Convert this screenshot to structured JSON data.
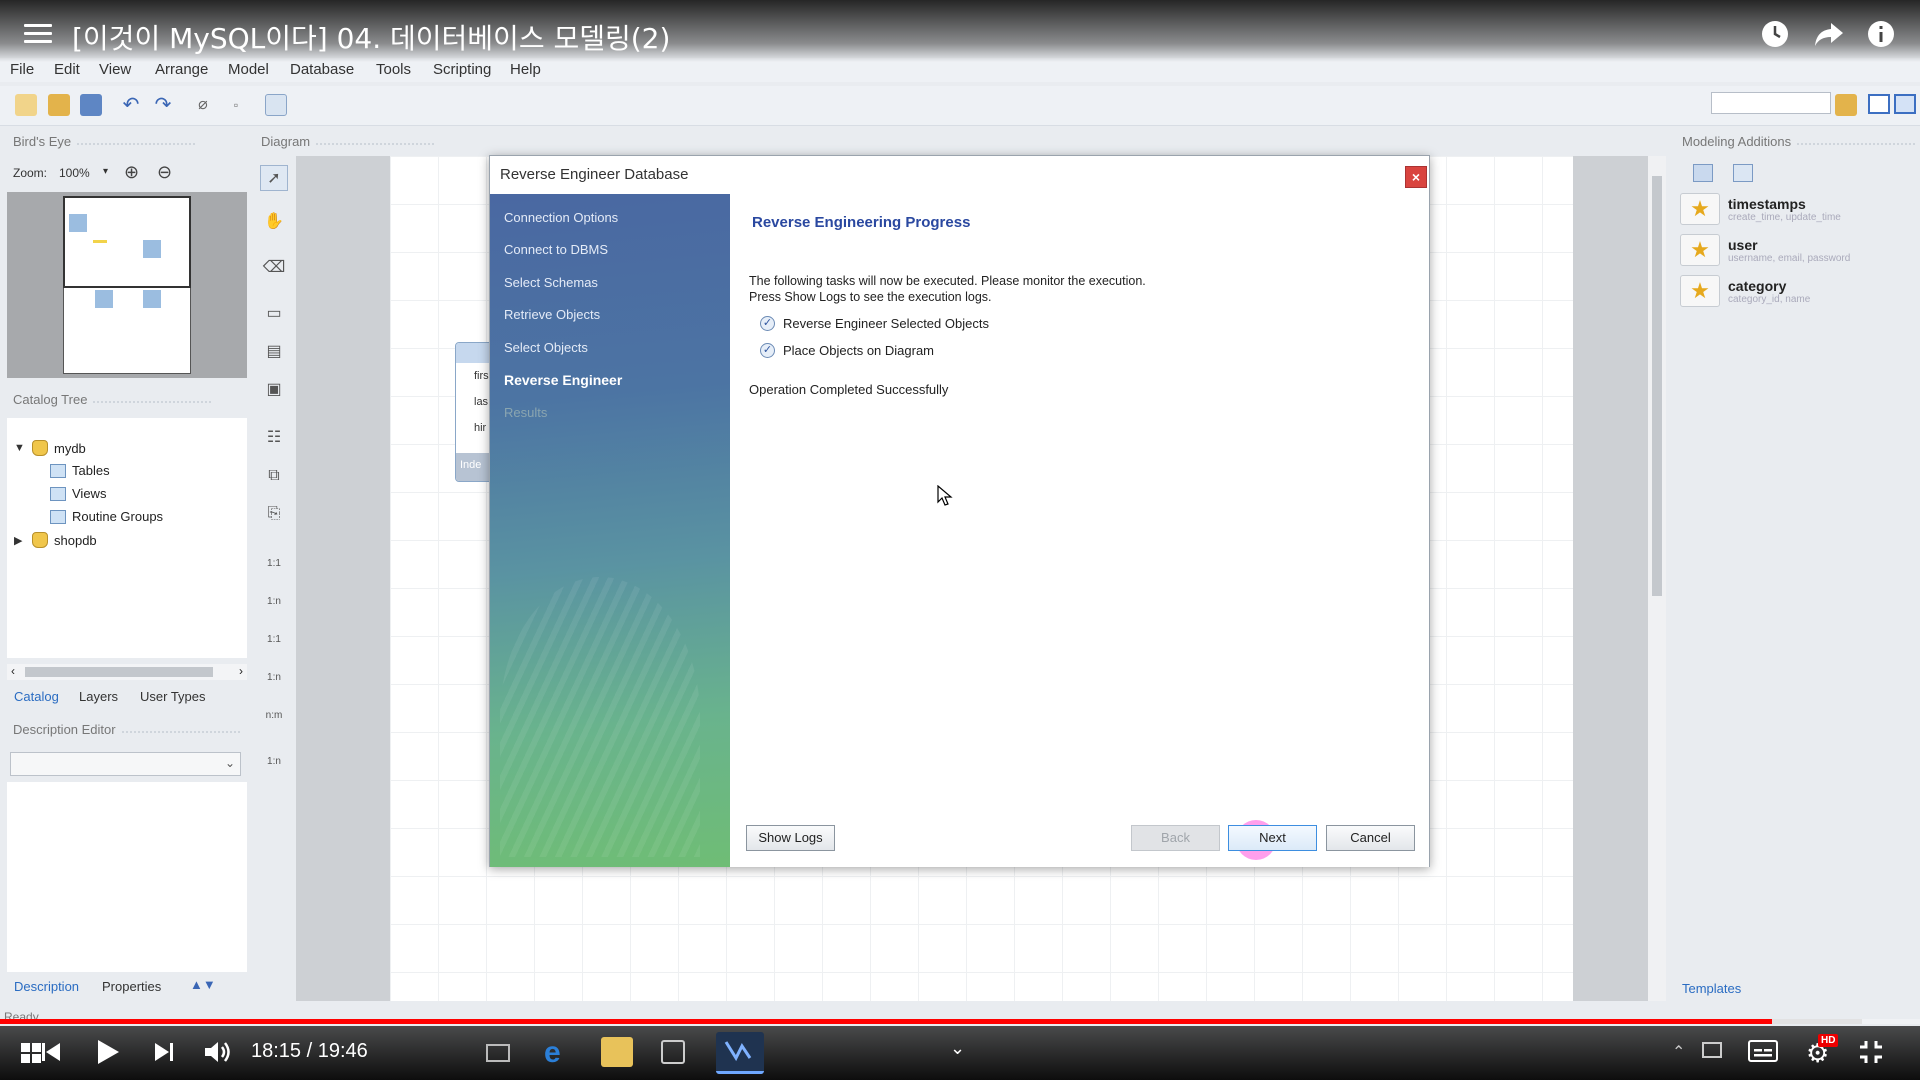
{
  "video": {
    "title": "[이것이 MySQL이다] 04. 데이터베이스 모델링(2)",
    "current_time": "18:15",
    "duration": "19:46",
    "time_display": "18:15 / 19:46",
    "progress_fraction": 0.923,
    "buffered_fraction": 0.97,
    "hd_badge": "HD"
  },
  "app": {
    "name": "MySQL Workbench",
    "menu": [
      "File",
      "Edit",
      "View",
      "Arrange",
      "Model",
      "Database",
      "Tools",
      "Scripting",
      "Help"
    ],
    "status": "Ready"
  },
  "left": {
    "birds_eye_title": "Bird's Eye",
    "zoom_label": "Zoom:",
    "zoom_value": "100%",
    "catalog_title": "Catalog Tree",
    "tree": {
      "mydb": "mydb",
      "tables": "Tables",
      "views": "Views",
      "routine_groups": "Routine Groups",
      "shopdb": "shopdb"
    },
    "tabs": [
      "Catalog",
      "Layers",
      "User Types"
    ],
    "description_title": "Description Editor",
    "bottom_tabs": [
      "Description",
      "Properties"
    ]
  },
  "diagram": {
    "title": "Diagram",
    "bg_table_rows": [
      "firs",
      "las",
      "hir"
    ],
    "bg_table_footer": "Inde"
  },
  "toolstrip": {
    "rel_labels": [
      "1:1",
      "1:n",
      "1:1",
      "1:n",
      "n:m",
      "1:n"
    ]
  },
  "right": {
    "title": "Modeling Additions",
    "items": [
      {
        "name": "timestamps",
        "sub": "create_time, update_time"
      },
      {
        "name": "user",
        "sub": "username, email, password"
      },
      {
        "name": "category",
        "sub": "category_id, name"
      }
    ],
    "templates_tab": "Templates"
  },
  "dialog": {
    "title": "Reverse Engineer Database",
    "steps": [
      {
        "label": "Connection Options",
        "state": "done"
      },
      {
        "label": "Connect to DBMS",
        "state": "done"
      },
      {
        "label": "Select Schemas",
        "state": "done"
      },
      {
        "label": "Retrieve Objects",
        "state": "done"
      },
      {
        "label": "Select Objects",
        "state": "done"
      },
      {
        "label": "Reverse Engineer",
        "state": "active"
      },
      {
        "label": "Results",
        "state": "disabled"
      }
    ],
    "heading": "Reverse Engineering Progress",
    "intro_line1": "The following tasks will now be executed. Please monitor the execution.",
    "intro_line2": "Press Show Logs to see the execution logs.",
    "tasks": [
      "Reverse Engineer Selected Objects",
      "Place Objects on Diagram"
    ],
    "result": "Operation Completed Successfully",
    "buttons": {
      "show_logs": "Show Logs",
      "back": "Back",
      "next": "Next",
      "cancel": "Cancel"
    }
  },
  "colors": {
    "progress": "#ff0000",
    "dialog_heading": "#2a48a0",
    "close_button": "#d9443f"
  }
}
